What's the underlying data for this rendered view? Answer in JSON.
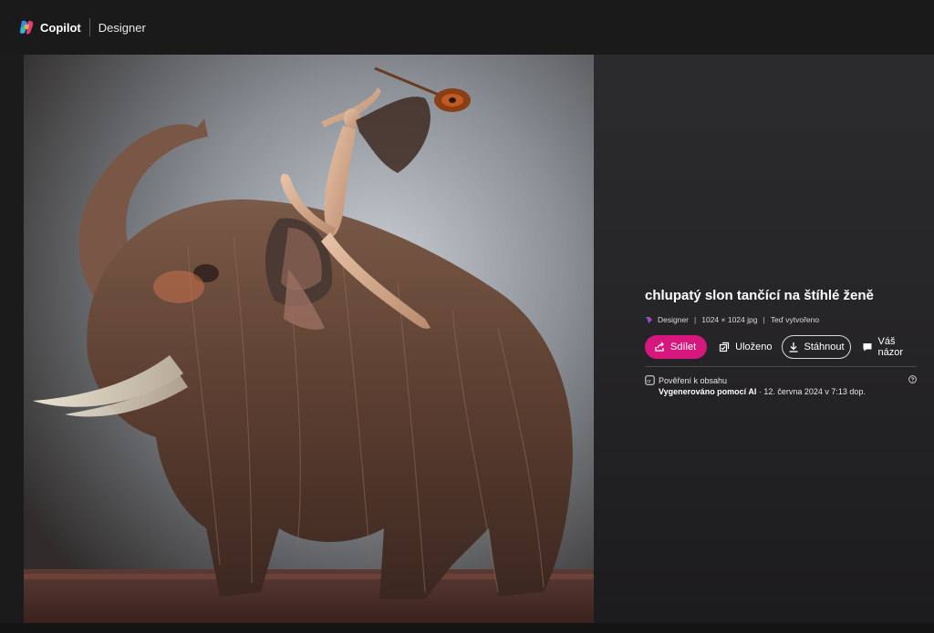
{
  "header": {
    "brand": "Copilot",
    "product": "Designer"
  },
  "image": {
    "title": "chlupatý slon tančící na štíhlé ženě",
    "source": "Designer",
    "dimensions": "1024 × 1024 jpg",
    "created": "Teď vytvořeno"
  },
  "actions": {
    "share": "Sdílet",
    "saved": "Uloženo",
    "download": "Stáhnout",
    "feedback": "Váš názor"
  },
  "credentials": {
    "label": "Pověření k obsahu",
    "generated": "Vygenerováno pomocí AI",
    "separator": " · ",
    "date": "12. června 2024 v 7:13 dop."
  },
  "colors": {
    "share_accent": "#d6177e",
    "background": "#1c1b1b"
  },
  "icons": [
    "copilot-logo-icon",
    "designer-logo-icon",
    "share-icon",
    "saved-icon",
    "download-icon",
    "feedback-icon",
    "content-credentials-icon",
    "help-icon"
  ]
}
